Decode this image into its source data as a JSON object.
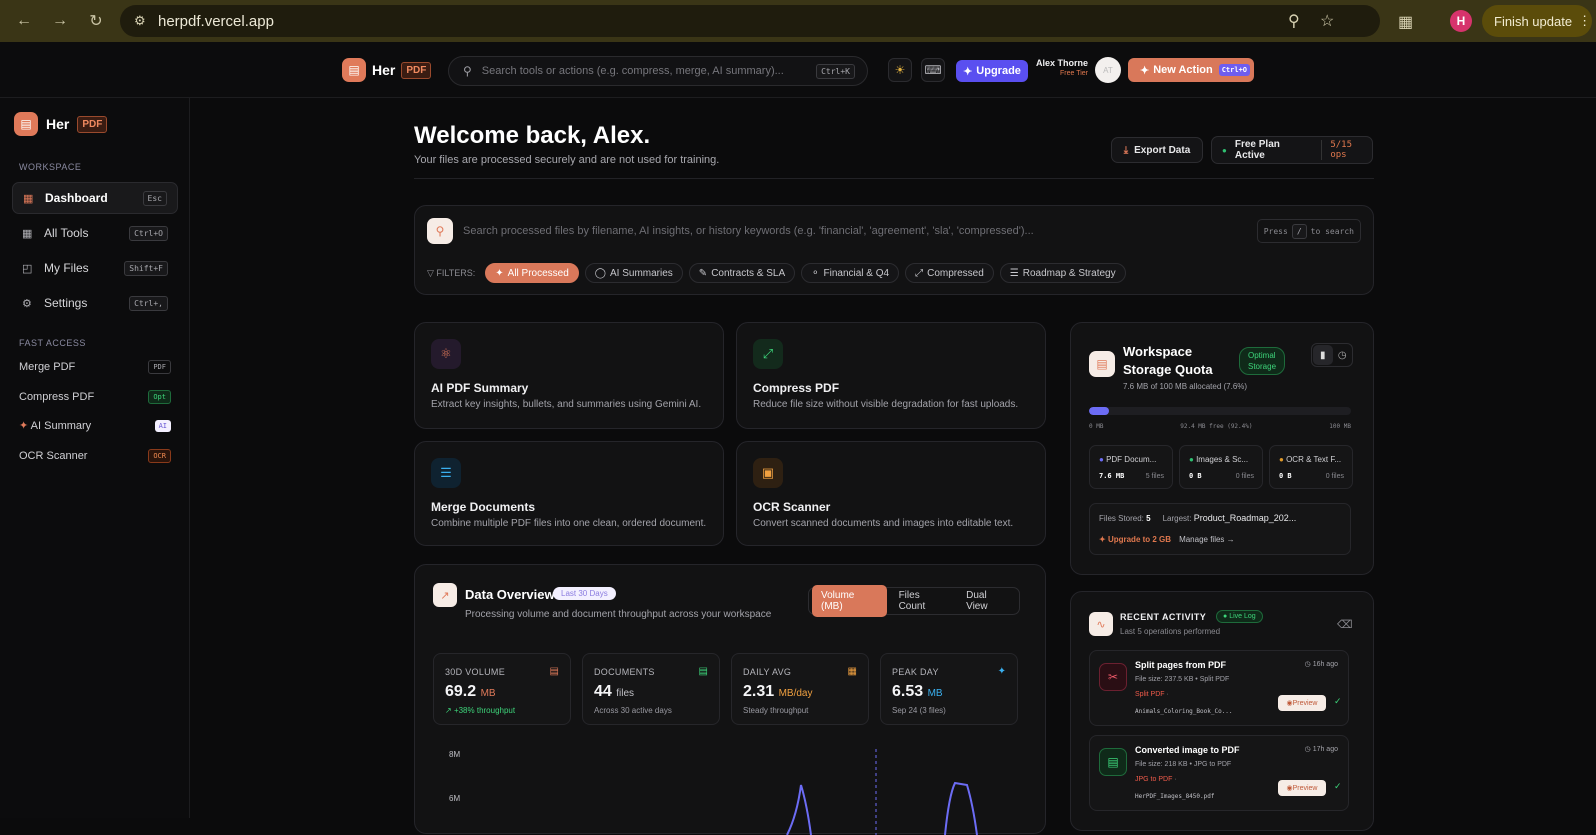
{
  "browser": {
    "url": "herpdf.vercel.app",
    "profile_initial": "H",
    "finish_update": "Finish update"
  },
  "brand": {
    "name": "Her",
    "badge": "PDF"
  },
  "topbar": {
    "search_placeholder": "Search tools or actions (e.g. compress, merge, AI summary)...",
    "search_shortcut": "Ctrl+K",
    "upgrade": "Upgrade",
    "user_name": "Alex Thorne",
    "user_tier": "Free Tier",
    "user_avatar": "AT",
    "new_action": "New Action",
    "new_action_shortcut": "Ctrl+O"
  },
  "sidebar": {
    "workspace_label": "WORKSPACE",
    "items": [
      {
        "label": "Dashboard",
        "key": "Esc"
      },
      {
        "label": "All Tools",
        "key": "Ctrl+O"
      },
      {
        "label": "My Files",
        "key": "Shift+F"
      },
      {
        "label": "Settings",
        "key": "Ctrl+,"
      }
    ],
    "fast_label": "FAST ACCESS",
    "fast": [
      {
        "label": "Merge PDF",
        "tag": "PDF"
      },
      {
        "label": "Compress PDF",
        "tag": "Opt"
      },
      {
        "label": "AI Summary",
        "tag": "AI"
      },
      {
        "label": "OCR Scanner",
        "tag": "OCR"
      }
    ]
  },
  "header": {
    "title": "Welcome back, Alex.",
    "subtitle": "Your files are processed securely and are not used for training.",
    "export": "Export Data",
    "plan": "Free Plan Active",
    "ops": "5/15 ops"
  },
  "filesearch": {
    "placeholder": "Search processed files by filename, AI insights, or history keywords (e.g. 'financial', 'agreement', 'sla', 'compressed')...",
    "hint_press": "Press",
    "hint_key": "/",
    "hint_rest": "to search",
    "filters_label": "FILTERS:",
    "filters": [
      "All Processed",
      "AI Summaries",
      "Contracts & SLA",
      "Financial & Q4",
      "Compressed",
      "Roadmap & Strategy"
    ]
  },
  "tools": [
    {
      "title": "AI PDF Summary",
      "desc": "Extract key insights, bullets, and summaries using Gemini AI."
    },
    {
      "title": "Compress PDF",
      "desc": "Reduce file size without visible degradation for fast uploads."
    },
    {
      "title": "Merge Documents",
      "desc": "Combine multiple PDF files into one clean, ordered document."
    },
    {
      "title": "OCR Scanner",
      "desc": "Convert scanned documents and images into editable text."
    }
  ],
  "overview": {
    "title": "Data Overview",
    "badge": "Last 30 Days",
    "subtitle": "Processing volume and document throughput across your workspace",
    "tabs": [
      "Volume (MB)",
      "Files Count",
      "Dual View"
    ],
    "stats": [
      {
        "label": "30D VOLUME",
        "value": "69.2",
        "unit": "MB",
        "sub": "+38% throughput"
      },
      {
        "label": "DOCUMENTS",
        "value": "44",
        "unit": "files",
        "sub": "Across 30 active days"
      },
      {
        "label": "DAILY AVG",
        "value": "2.31",
        "unit": "MB/day",
        "sub": "Steady throughput"
      },
      {
        "label": "PEAK DAY",
        "value": "6.53",
        "unit": "MB",
        "sub": "Sep 24 (3 files)"
      }
    ],
    "y_ticks": [
      "8M",
      "6M"
    ]
  },
  "storage": {
    "title1": "Workspace",
    "title2": "Storage Quota",
    "badge1": "Optimal",
    "badge2": "Storage",
    "used": "7.6 MB of 100 MB allocated (7.6%)",
    "fill": 0.076,
    "min": "0 MB",
    "free": "92.4 MB free (92.4%)",
    "max": "100 MB",
    "cats": [
      {
        "name": "PDF Docum...",
        "size": "7.6 MB",
        "files": "5 files",
        "color": "#6c6cf5"
      },
      {
        "name": "Images & Sc...",
        "size": "0 B",
        "files": "0 files",
        "color": "#2fbf71"
      },
      {
        "name": "OCR & Text F...",
        "size": "0 B",
        "files": "0 files",
        "color": "#e09a2a"
      }
    ],
    "stored_label": "Files Stored:",
    "stored": "5",
    "largest_label": "Largest:",
    "largest": "Product_Roadmap_202...",
    "upgrade": "Upgrade to 2 GB",
    "manage": "Manage files →"
  },
  "activity": {
    "title": "RECENT ACTIVITY",
    "badge": "Live Log",
    "sub": "Last 5 operations performed",
    "items": [
      {
        "title": "Split pages from PDF",
        "time": "16h ago",
        "meta": "File size: 237.5 KB • Split PDF",
        "tool": "Split PDF",
        "file": "Animals_Coloring_Book_Co...",
        "preview": "Preview"
      },
      {
        "title": "Converted image to PDF",
        "time": "17h ago",
        "meta": "File size: 218 KB • JPG to PDF",
        "tool": "JPG to PDF",
        "file": "HerPDF_Images_8450.pdf",
        "preview": "Preview"
      }
    ]
  }
}
